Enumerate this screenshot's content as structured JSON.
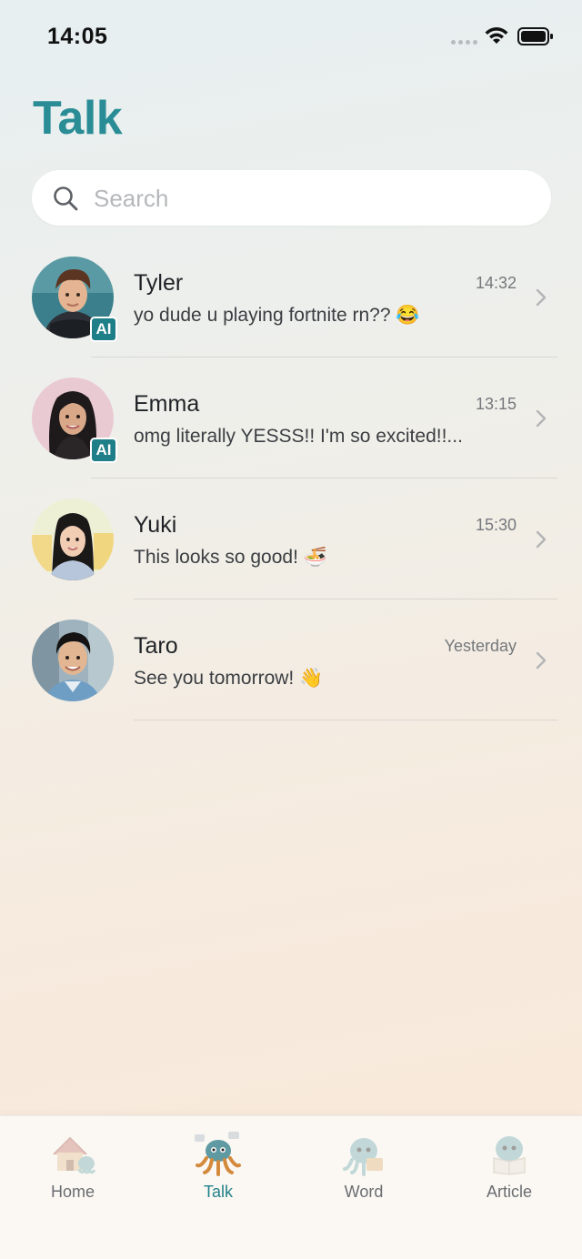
{
  "status_bar": {
    "time": "14:05"
  },
  "header": {
    "title": "Talk"
  },
  "search": {
    "placeholder": "Search"
  },
  "chats": [
    {
      "name": "Tyler",
      "time": "14:32",
      "preview": "yo dude u playing fortnite rn?? 😂",
      "ai": true,
      "ai_label": "AI"
    },
    {
      "name": "Emma",
      "time": "13:15",
      "preview": "omg literally YESSS!! I'm so excited!!...",
      "ai": true,
      "ai_label": "AI"
    },
    {
      "name": "Yuki",
      "time": "15:30",
      "preview": "This looks so good! 🍜",
      "ai": false
    },
    {
      "name": "Taro",
      "time": "Yesterday",
      "preview": "See you tomorrow! 👋",
      "ai": false
    }
  ],
  "tabs": [
    {
      "label": "Home",
      "icon": "house-octopus-icon",
      "active": false
    },
    {
      "label": "Talk",
      "icon": "chatting-octopus-icon",
      "active": true
    },
    {
      "label": "Word",
      "icon": "word-octopus-icon",
      "active": false
    },
    {
      "label": "Article",
      "icon": "reading-octopus-icon",
      "active": false
    }
  ],
  "colors": {
    "accent": "#2a8d96",
    "ai_badge": "#1f7f88"
  }
}
